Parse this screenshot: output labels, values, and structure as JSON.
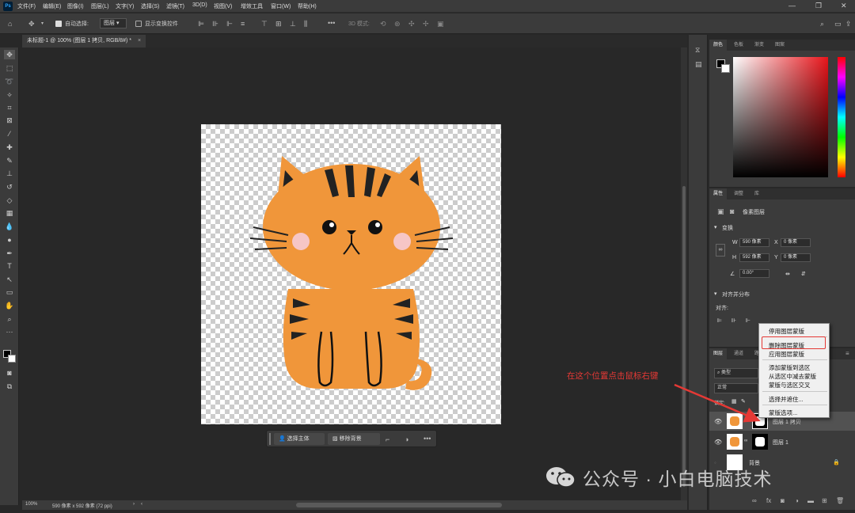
{
  "menubar": {
    "app_icon": "Ps",
    "items": [
      "文件(F)",
      "编辑(E)",
      "图像(I)",
      "图层(L)",
      "文字(Y)",
      "选择(S)",
      "滤镜(T)",
      "3D(D)",
      "视图(V)",
      "增效工具",
      "窗口(W)",
      "帮助(H)"
    ]
  },
  "options": {
    "auto_select_label": "自动选择:",
    "auto_select_value": "图层",
    "show_transform_label": "显示变换控件",
    "mode3d_label": "3D 模式:"
  },
  "document": {
    "tab_title": "未标题-1 @ 100% (图层 1 拷贝, RGB/8#) *"
  },
  "context_bar": {
    "select_subject": "选择主体",
    "remove_bg": "移除背景"
  },
  "statusbar": {
    "zoom": "100%",
    "doc_info": "590 像素 x 592 像素 (72 ppi)"
  },
  "color_panel": {
    "tabs": [
      "颜色",
      "色板",
      "渐变",
      "图案"
    ]
  },
  "properties_panel": {
    "tabs": [
      "属性",
      "调整",
      "库"
    ],
    "layer_type": "像素图层",
    "transform_header": "变换",
    "w_label": "W",
    "w_value": "590 像素",
    "h_label": "H",
    "h_value": "592 像素",
    "x_label": "X",
    "x_value": "0 像素",
    "y_label": "Y",
    "y_value": "0 像素",
    "angle_value": "0.00°",
    "align_header": "对齐并分布",
    "align_label": "对齐:"
  },
  "layers_panel": {
    "tabs": [
      "图层",
      "通道",
      "路径"
    ],
    "filter_label": "类型",
    "blend_mode": "正常",
    "lock_label": "锁定:",
    "layers": [
      {
        "name": "图层 1 拷贝",
        "selected": true
      },
      {
        "name": "图层 1",
        "selected": false
      },
      {
        "name": "背景",
        "selected": false
      }
    ]
  },
  "context_menu": {
    "items": [
      "停用图层蒙版",
      "删除图层蒙版",
      "应用图层蒙版",
      "添加蒙版到选区",
      "从选区中减去蒙版",
      "蒙版与选区交叉",
      "选择并遮住...",
      "蒙版选项..."
    ]
  },
  "annotation": {
    "text": "在这个位置点击鼠标右键"
  },
  "watermark": {
    "text": "公众号 · 小白电脑技术"
  },
  "colors": {
    "accent_red": "#e53935",
    "cat_orange": "#f0963a"
  }
}
